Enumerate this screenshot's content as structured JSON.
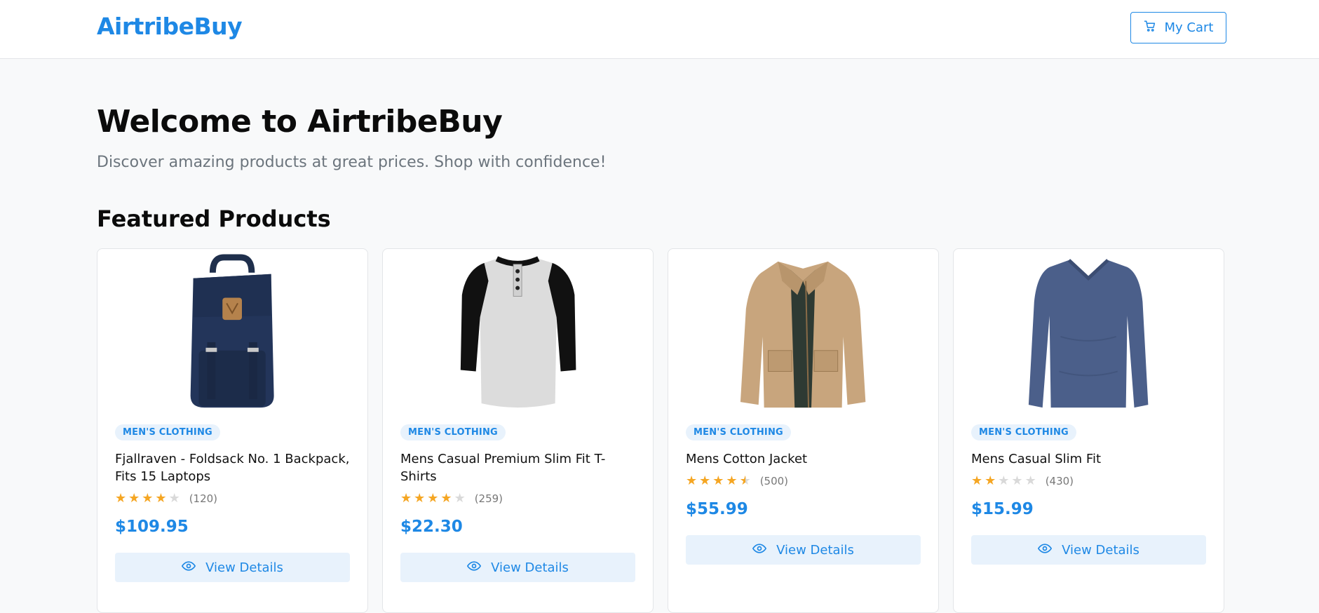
{
  "header": {
    "logo": "AirtribeBuy",
    "cart_label": "My Cart"
  },
  "hero": {
    "title": "Welcome to AirtribeBuy",
    "subtitle": "Discover amazing products at great prices. Shop with confidence!"
  },
  "section": {
    "title": "Featured Products"
  },
  "colors": {
    "accent": "#1e88e5",
    "star": "#f5a623"
  },
  "products": [
    {
      "category": "MEN'S CLOTHING",
      "name": "Fjallraven - Foldsack No. 1 Backpack, Fits 15 Laptops",
      "rating": 4,
      "rating_count": "(120)",
      "price": "$109.95",
      "button_label": "View Details",
      "image_icon": "backpack-image"
    },
    {
      "category": "MEN'S CLOTHING",
      "name": "Mens Casual Premium Slim Fit T-Shirts",
      "rating": 4,
      "rating_count": "(259)",
      "price": "$22.30",
      "button_label": "View Details",
      "image_icon": "raglan-shirt-image"
    },
    {
      "category": "MEN'S CLOTHING",
      "name": "Mens Cotton Jacket",
      "rating": 4.5,
      "rating_count": "(500)",
      "price": "$55.99",
      "button_label": "View Details",
      "image_icon": "jacket-image"
    },
    {
      "category": "MEN'S CLOTHING",
      "name": "Mens Casual Slim Fit",
      "rating": 2,
      "rating_count": "(430)",
      "price": "$15.99",
      "button_label": "View Details",
      "image_icon": "long-sleeve-shirt-image"
    }
  ]
}
